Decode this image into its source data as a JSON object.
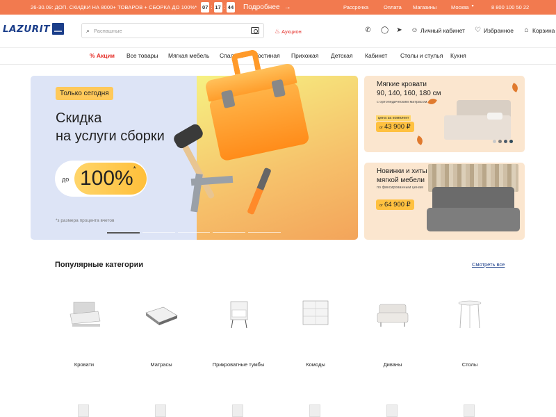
{
  "promo": {
    "text": "26-30.09: ДОП. СКИДКИ НА 8000+ ТОВАРОВ + СБОРКА ДО 100%*",
    "timer": [
      "07",
      "17",
      "44"
    ],
    "more": "Подробнее",
    "links": [
      "Рассрочка",
      "Оплата",
      "Магазины",
      "Москва"
    ],
    "phone": "8 800 100 50 22"
  },
  "header": {
    "logo": "LAZURIT",
    "search_placeholder": "Распашные",
    "auction": "Аукцион",
    "account": "Личный кабинет",
    "favorites": "Избранное",
    "cart": "Корзина"
  },
  "nav": {
    "items": [
      "% Акции",
      "Все товары",
      "Мягкая мебель",
      "Спальня",
      "Гостиная",
      "Прихожая",
      "Детская",
      "Кабинет",
      "Столы и стулья",
      "Кухня"
    ]
  },
  "hero": {
    "tag": "Только сегодня",
    "title_1": "Скидка",
    "title_2": "на услуги сборки",
    "pre": "до",
    "percent": "100%",
    "percent_mark": "*",
    "note": "*з размера процента вчетов"
  },
  "banner1": {
    "title_1": "Мягкие кровати",
    "title_2": "90, 140, 160, 180 см",
    "subtitle": "с ортопедическим матрасом",
    "badge": "цена за комплект",
    "price_prefix": "от",
    "price": "43 900 ₽",
    "swatch_colors": [
      "#c9c9c9",
      "#7b7b7b",
      "#4b5b6b",
      "#2f4a5a"
    ]
  },
  "banner2": {
    "title_1": "Новинки и хиты",
    "title_2": "мягкой мебели",
    "subtitle": "по фиксированным ценам",
    "price_prefix": "от",
    "price": "64 900 ₽"
  },
  "categories": {
    "title": "Популярные категории",
    "see_all": "Смотреть все",
    "items": [
      "Кровати",
      "Матрасы",
      "Прикроватные тумбы",
      "Комоды",
      "Диваны",
      "Столы"
    ]
  },
  "colors": {
    "accent": "#f27a4f",
    "brand": "#1b3e8a",
    "sale": "#e5302a",
    "price": "#ffc140"
  }
}
